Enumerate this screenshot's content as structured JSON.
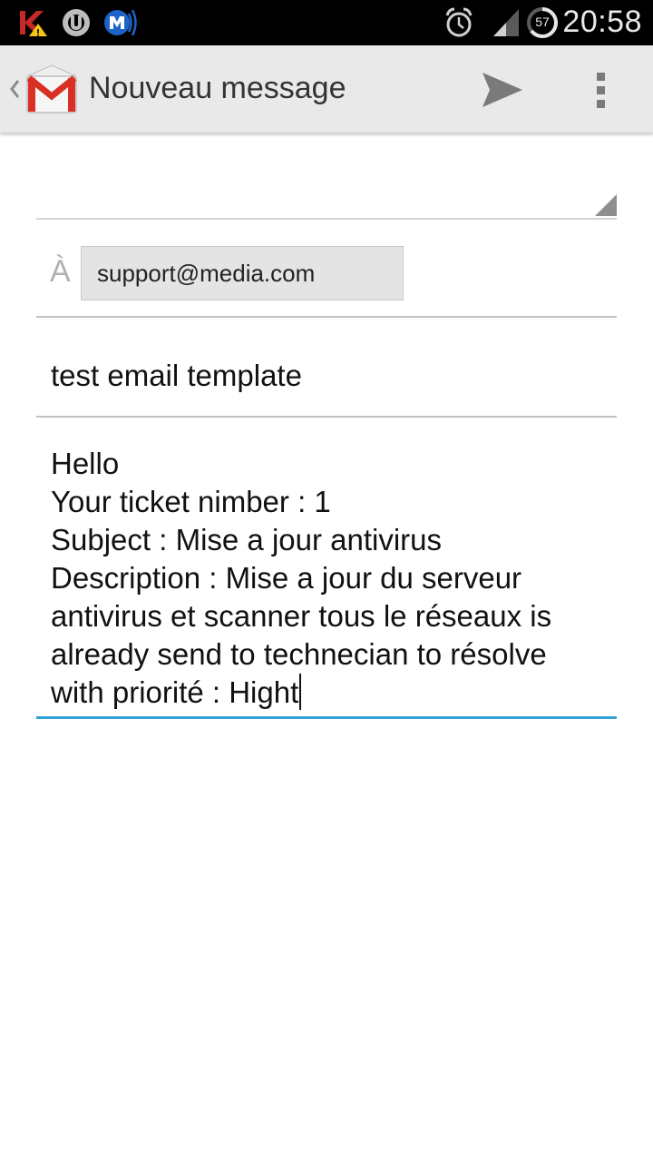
{
  "status_bar": {
    "time": "20:58",
    "battery_level": "57",
    "icons": [
      "kaspersky-icon",
      "utorrent-icon",
      "wireless-notification-icon",
      "alarm-icon",
      "signal-icon",
      "battery-icon"
    ]
  },
  "action_bar": {
    "title": "Nouveau message",
    "app_icon": "gmail-icon",
    "actions": [
      "send-icon",
      "overflow-menu-icon"
    ]
  },
  "compose": {
    "from_value": "",
    "to_label": "À",
    "recipients": [
      "support@media.com"
    ],
    "subject": "test email template",
    "body_lines": [
      "Hello",
      "Your ticket nimber :  1",
      "Subject :  Mise a jour antivirus",
      "Description :  Mise a jour du serveur",
      "antivirus et scanner tous le réseaux is",
      "already send to technecian to résolve",
      "with priorité :  Hight"
    ]
  },
  "colors": {
    "status_bar": "#000000",
    "action_bar": "#e9e9e9",
    "focus_accent": "#33a3d6",
    "gmail_red": "#d93025",
    "chip_background": "#e4e4e4"
  }
}
